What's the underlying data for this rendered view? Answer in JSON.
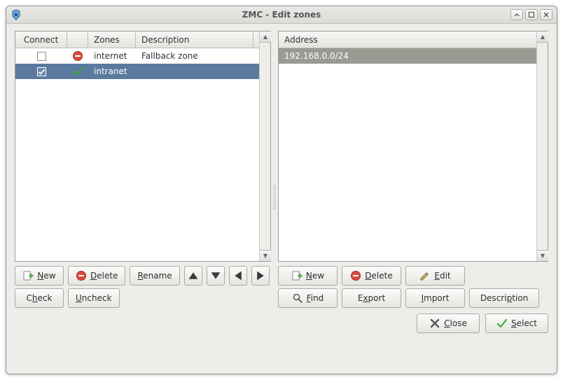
{
  "window": {
    "title": "ZMC - Edit zones"
  },
  "zones_table": {
    "headers": {
      "connect": "Connect",
      "zones": "Zones",
      "description": "Description"
    },
    "rows": [
      {
        "connect_checked": false,
        "status": "error",
        "name": "internet",
        "description": "Fallback zone",
        "selected": false
      },
      {
        "connect_checked": true,
        "status": "ok",
        "name": "intranet",
        "description": "",
        "selected": true
      }
    ]
  },
  "address_table": {
    "header": "Address",
    "rows": [
      {
        "value": "192.168.0.0/24",
        "selected": true
      }
    ]
  },
  "left_buttons": {
    "row1": {
      "new": "New",
      "delete": "Delete",
      "rename": "Rename"
    },
    "row2": {
      "check": "Check",
      "uncheck": "Uncheck"
    }
  },
  "right_buttons": {
    "row1": {
      "new": "New",
      "delete": "Delete",
      "edit": "Edit"
    },
    "row2": {
      "find": "Find",
      "export": "Export",
      "import": "Import",
      "description": "Description"
    }
  },
  "footer": {
    "close": "Close",
    "select": "Select"
  }
}
